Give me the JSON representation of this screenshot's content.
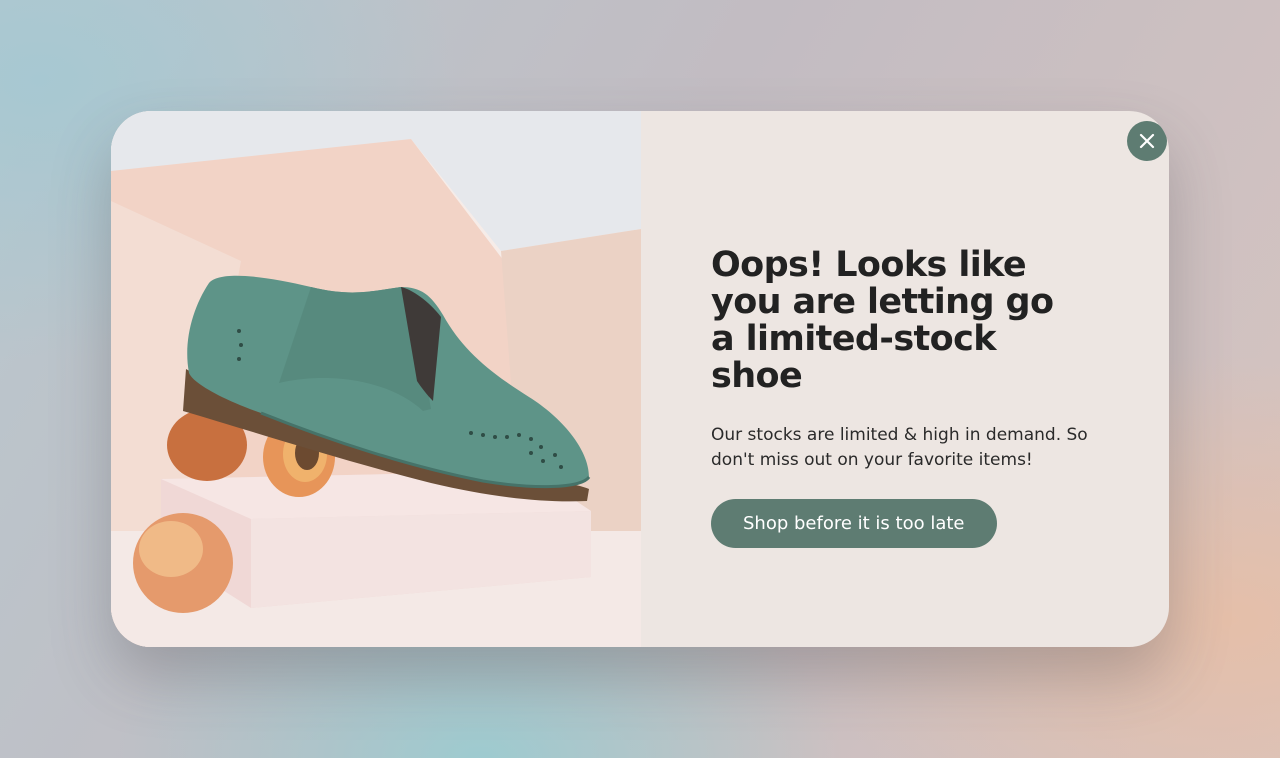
{
  "popup": {
    "headline": "Oops! Looks like you are letting go a limited-stock shoe",
    "body": "Our stocks are limited & high in demand. So don't miss out on your favorite items!",
    "cta_label": "Shop before it is too late",
    "image_subject": "teal suede brogue shoe with peaches on a pink box"
  },
  "icons": {
    "close": "close-icon"
  },
  "colors": {
    "accent": "#5e7c72",
    "panel_background": "#ede6e2",
    "headline_text": "#222222",
    "shoe": "#5e9488"
  }
}
